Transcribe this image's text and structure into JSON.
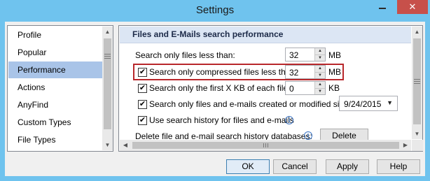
{
  "window": {
    "title": "Settings",
    "close_glyph": "✕"
  },
  "nav": {
    "items": [
      {
        "label": "Profile"
      },
      {
        "label": "Popular"
      },
      {
        "label": "Performance",
        "selected": true
      },
      {
        "label": "Actions"
      },
      {
        "label": "AnyFind"
      },
      {
        "label": "Custom Types"
      },
      {
        "label": "File Types"
      }
    ]
  },
  "panel": {
    "header": "Files and E-Mails search performance",
    "rows": {
      "files_less_than": {
        "label": "Search only files less than:",
        "value": "32",
        "unit": "MB"
      },
      "compressed_less_than": {
        "label": "Search only compressed files less than:",
        "value": "32",
        "unit": "MB",
        "checked": true
      },
      "first_kb": {
        "label": "Search only the first X KB of each file:",
        "value": "0",
        "unit": "KB",
        "checked": true
      },
      "created_since": {
        "label": "Search only files and e-mails created or modified since:",
        "date": "9/24/2015",
        "checked": true
      },
      "use_history": {
        "label": "Use search history for files and e-mails",
        "checked": true
      },
      "delete_history": {
        "label": "Delete file and e-mail search history databases:",
        "button": "Delete"
      }
    },
    "check_glyph": "✔",
    "info_glyph": "i"
  },
  "buttons": {
    "ok": "OK",
    "cancel": "Cancel",
    "apply": "Apply",
    "help": "Help"
  },
  "colors": {
    "titlebar": "#6fc3ee",
    "close": "#c7504a",
    "selection": "#a9c4e8",
    "highlight": "#b8272b",
    "header_bg": "#dce6f4"
  }
}
